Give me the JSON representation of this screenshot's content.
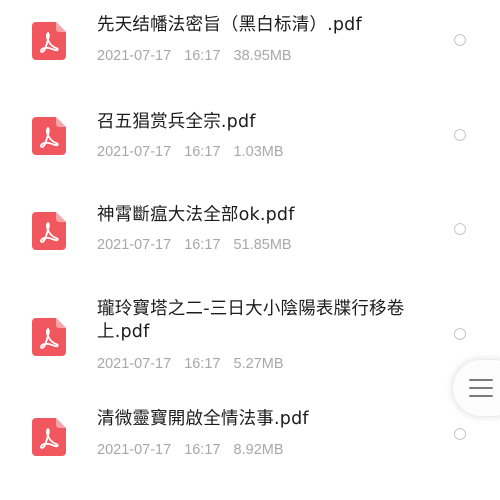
{
  "files": [
    {
      "name": "先天结幡法密旨（黑白标清）.pdf",
      "date": "2021-07-17",
      "time": "16:17",
      "size": "38.95MB",
      "icon": "pdf-file-icon"
    },
    {
      "name": "召五猖赏兵全宗.pdf",
      "date": "2021-07-17",
      "time": "16:17",
      "size": "1.03MB",
      "icon": "pdf-file-icon"
    },
    {
      "name": "神霄斷瘟大法全部ok.pdf",
      "date": "2021-07-17",
      "time": "16:17",
      "size": "51.85MB",
      "icon": "pdf-file-icon"
    },
    {
      "name": "瓏玲寶塔之二-三日大小陰陽表牒行移卷上.pdf",
      "date": "2021-07-17",
      "time": "16:17",
      "size": "5.27MB",
      "icon": "pdf-file-icon"
    },
    {
      "name": "清微靈寶開啟全情法事.pdf",
      "date": "2021-07-17",
      "time": "16:17",
      "size": "8.92MB",
      "icon": "pdf-file-icon"
    }
  ],
  "colors": {
    "pdf_icon": "#f0575f",
    "text_primary": "#1c1c1c",
    "text_secondary": "#a8a8a8"
  },
  "floating_menu_icon": "hamburger-menu-icon"
}
